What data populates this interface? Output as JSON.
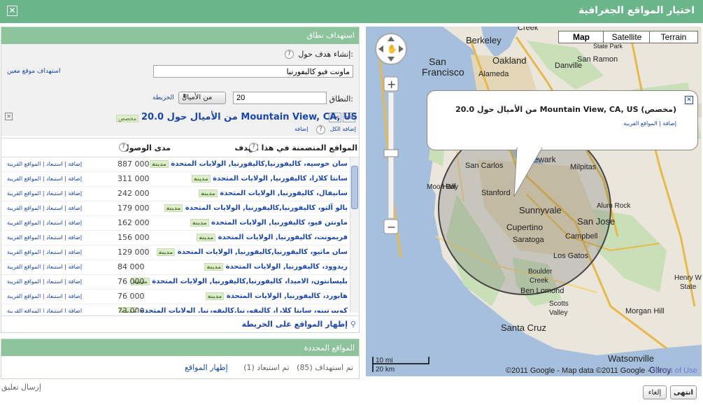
{
  "dialog": {
    "title": "اختيار المواقع الجغرافية",
    "close_glyph": "✕"
  },
  "targeting": {
    "header": "استهداف نطاق",
    "create_label": "إنشاء هدف حول:",
    "location_value": "ماونت فيو كاليفورنيا",
    "target_specific_link": "استهداف موقع معين",
    "radius_label": "النطاق:",
    "radius_value": "20",
    "unit_value": "من الأميال",
    "map_link": "الخريطة",
    "result_title": "20.0 من الأميال حول Mountain View, CA, US",
    "custom_tag": "مخصص",
    "add_all": "إضافة الكل",
    "add": "إضافة",
    "nav_next": ">>",
    "nav_prev": "<<"
  },
  "list": {
    "col_locations": "المواقع المتضمنة في هذا الهدف",
    "col_reach": "مدى الوصول",
    "city_tag": "مدينة",
    "actions": "إضافة | استبعاد | المواقع القريبة",
    "rows": [
      {
        "name": "سان خوسيه، كاليفورنيا,كاليفورنيا, الولايات المتحدة",
        "reach": "887 000"
      },
      {
        "name": "سانتا كلارا، كاليفورنيا, الولايات المتحدة",
        "reach": "311 000"
      },
      {
        "name": "سانيفال، كاليفورنيا, الولايات المتحدة",
        "reach": "242 000"
      },
      {
        "name": "بالو آلتو، كاليفورنيا,كاليفورنيا, الولايات المتحدة",
        "reach": "179 000"
      },
      {
        "name": "ماونتن فيو، كاليفورنيا, الولايات المتحدة",
        "reach": "162 000"
      },
      {
        "name": "فريمونت، كاليفورنيا, الولايات المتحدة",
        "reach": "156 000"
      },
      {
        "name": "سان ماتيو، كاليفورنيا,كاليفورنيا, الولايات المتحدة",
        "reach": "129 000"
      },
      {
        "name": "ريدوود، كاليفورنيا, الولايات المتحدة",
        "reach": "84 000"
      },
      {
        "name": "بليسانتون، الاميدا، كاليفورنيا,كاليفورنيا, الولايات المتحدة",
        "reach": "76 000"
      },
      {
        "name": "هايورد، كاليفورنيا, الولايات المتحدة",
        "reach": "76 000"
      },
      {
        "name": "كوبيرتينو، سانتا كلارا، كاليفورنيا,كاليفورنيا, الولايات المتحدة",
        "reach": "73 000"
      }
    ],
    "show_on_map": "إظهار المواقع على الخريطة"
  },
  "selected": {
    "header": "المواقع المحددة",
    "summary": "تم استهداف (85)   تم استبعاد (1)",
    "show_link": "إظهار المواقع"
  },
  "map": {
    "types": [
      "Map",
      "Satellite",
      "Terrain"
    ],
    "active_type": "Map",
    "bubble_title": "20.0 من الأميال حول Mountain View, CA, US (مخصص)",
    "bubble_links": "إضافة | المواقع القريبة",
    "scale_mi": "10 mi",
    "scale_km": "20 km",
    "copyright": "©2011 Google - Map data ©2011 Google -",
    "terms": "Terms of Use",
    "cities": [
      {
        "name": "Creek"
      },
      {
        "name": "Berkeley"
      },
      {
        "name": "Oakland"
      },
      {
        "name": "Alameda"
      },
      {
        "name": "San Ramon"
      },
      {
        "name": "Danville"
      },
      {
        "name": "State Park"
      },
      {
        "name": "San"
      },
      {
        "name": "Francisco"
      },
      {
        "name": "Daly City"
      },
      {
        "name": "Newark"
      },
      {
        "name": "Half"
      },
      {
        "name": "Moon Bay"
      },
      {
        "name": "San Carlos"
      },
      {
        "name": "Stanford"
      },
      {
        "name": "Milpitas"
      },
      {
        "name": "Sunnyvale"
      },
      {
        "name": "Alum Rock"
      },
      {
        "name": "Cupertino"
      },
      {
        "name": "San Jose"
      },
      {
        "name": "Campbell"
      },
      {
        "name": "Saratoga"
      },
      {
        "name": "Los Gatos"
      },
      {
        "name": "Boulder"
      },
      {
        "name": "Creek"
      },
      {
        "name": "Ben Lomond"
      },
      {
        "name": "Scotts"
      },
      {
        "name": "Valley"
      },
      {
        "name": "Morgan Hill"
      },
      {
        "name": "Santa Cruz"
      },
      {
        "name": "Watsonville"
      },
      {
        "name": "Henry W"
      },
      {
        "name": "State"
      },
      {
        "name": "Gilroy"
      }
    ]
  },
  "footer": {
    "feedback": "إرسال تعليق",
    "done": "انتهى",
    "cancel": "إلغاء"
  }
}
